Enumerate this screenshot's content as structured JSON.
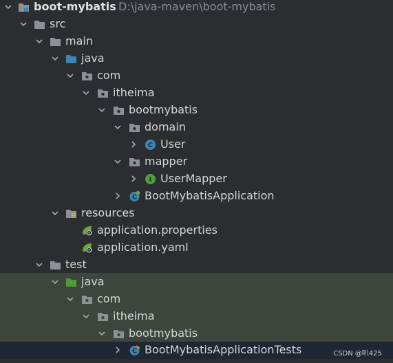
{
  "project": {
    "name": "boot-mybatis",
    "path": "D:\\java-maven\\boot-mybatis"
  },
  "tree": {
    "src": "src",
    "main": "main",
    "main_java": "java",
    "main_com": "com",
    "main_itheima": "itheima",
    "main_bootmybatis": "bootmybatis",
    "domain": "domain",
    "user_class": "User",
    "mapper": "mapper",
    "usermapper": "UserMapper",
    "app_class": "BootMybatisApplication",
    "resources": "resources",
    "app_properties": "application.properties",
    "app_yaml": "application.yaml",
    "test": "test",
    "test_java": "java",
    "test_com": "com",
    "test_itheima": "itheima",
    "test_bootmybatis": "bootmybatis",
    "tests_class": "BootMybatisApplicationTests"
  },
  "watermark": "CSDN @叭425",
  "colors": {
    "background": "#2b2d30",
    "test_highlight": "#3e453d",
    "selected_row": "#1f2733",
    "folder": "#8c9196",
    "source_root": "#3c86b5",
    "test_root": "#4f9a3a",
    "class_icon": "#3c86b5",
    "interface_icon": "#4e9f3d",
    "spring": "#6ba83f"
  },
  "icons": {
    "module": "module-folder-icon",
    "folder": "folder-icon",
    "package": "package-icon",
    "source_root": "source-root-icon",
    "test_root": "test-root-icon",
    "resources_root": "resources-root-icon",
    "class": "class-icon",
    "interface": "interface-icon",
    "spring_app": "spring-boot-class-icon",
    "spring_config": "spring-config-icon"
  }
}
